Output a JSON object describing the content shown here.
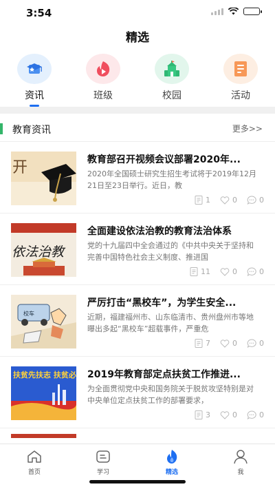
{
  "status_bar": {
    "time": "3:54"
  },
  "header": {
    "title": "精选"
  },
  "categories": [
    {
      "label": "资讯",
      "icon": "graduation-cap-icon",
      "active": true
    },
    {
      "label": "班级",
      "icon": "play-icon",
      "active": false
    },
    {
      "label": "校园",
      "icon": "school-building-icon",
      "active": false
    },
    {
      "label": "活动",
      "icon": "document-icon",
      "active": false
    }
  ],
  "section": {
    "title": "教育资讯",
    "more": "更多>>"
  },
  "news": [
    {
      "title": "教育部召开视频会议部署2020年...",
      "summary": "2020年全国硕士研究生招生考试将于2019年12月21日至23日举行。近日，教",
      "reads": "1",
      "likes": "0",
      "comments": "0",
      "thumb_text": "开"
    },
    {
      "title": "全面建设依法治教的教育法治体系",
      "summary": "党的十九届四中全会通过的《中共中央关于坚持和完善中国特色社会主义制度、推进国",
      "reads": "11",
      "likes": "0",
      "comments": "0",
      "thumb_text": "依法治教"
    },
    {
      "title": "严厉打击“黑校车”，为学生安全...",
      "summary": "近期，福建福州市、山东临清市、贵州盘州市等地曝出多起“黑校车”超载事件，严重危",
      "reads": "7",
      "likes": "0",
      "comments": "0",
      "thumb_text": "校车"
    },
    {
      "title": "2019年教育部定点扶贫工作推进...",
      "summary": "为全面贯彻党中央和国务院关于脱贫攻坚特别是对中央单位定点扶贫工作的部署要求，",
      "reads": "3",
      "likes": "0",
      "comments": "0",
      "thumb_text": "扶贫先扶志 扶贫必扶智"
    }
  ],
  "tabbar": [
    {
      "label": "首页",
      "icon": "home-icon",
      "active": false
    },
    {
      "label": "学习",
      "icon": "study-icon",
      "active": false
    },
    {
      "label": "精选",
      "icon": "flame-icon",
      "active": true
    },
    {
      "label": "我",
      "icon": "user-icon",
      "active": false
    }
  ],
  "colors": {
    "accent": "#1e6ff1",
    "section_bar": "#34b56a"
  }
}
